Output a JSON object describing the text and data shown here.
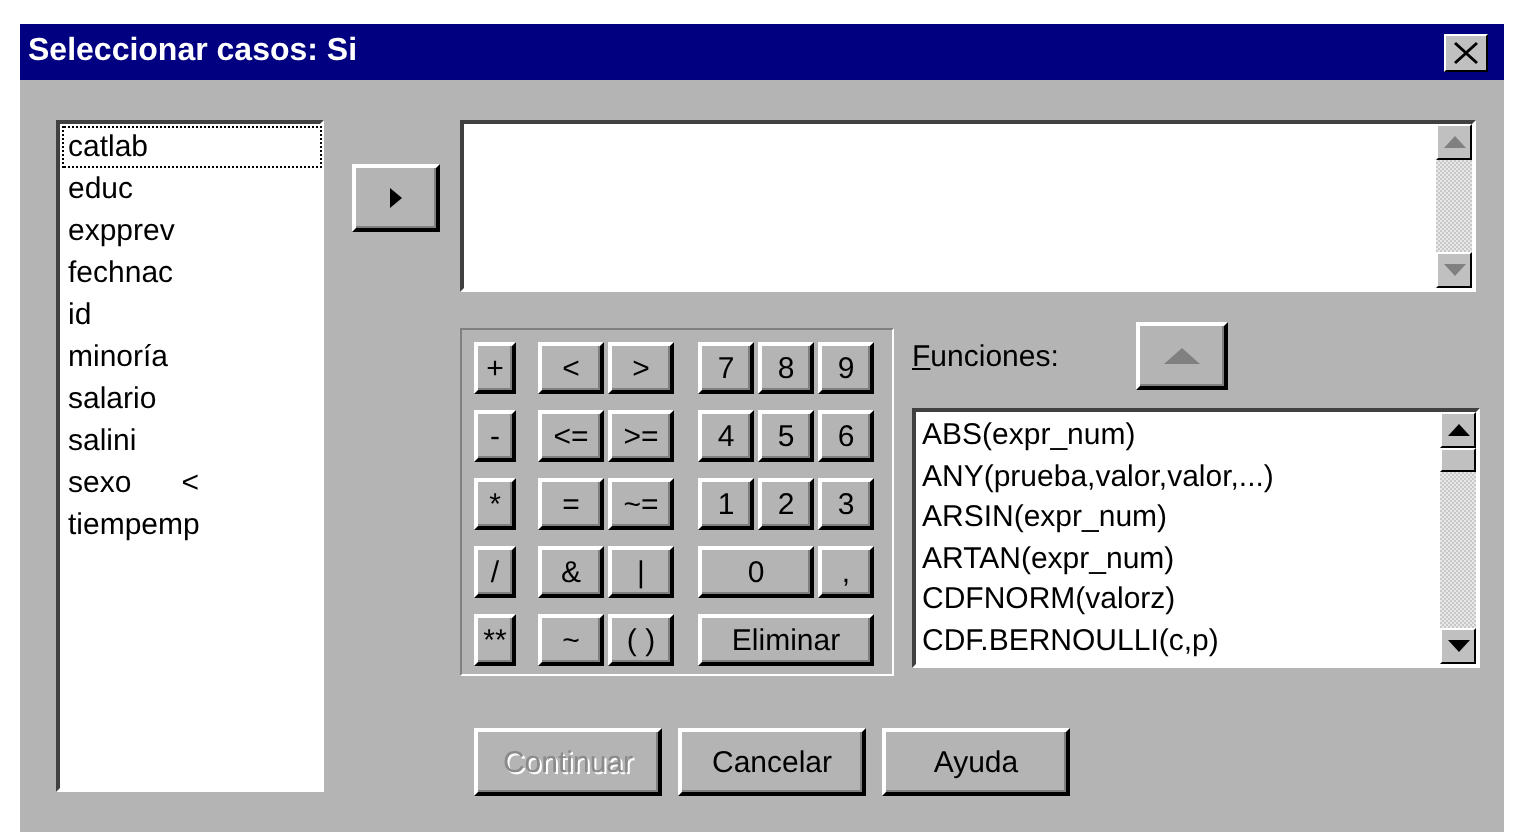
{
  "window": {
    "title": "Seleccionar casos: Si"
  },
  "variables": [
    {
      "name": "catlab",
      "selected": true
    },
    {
      "name": "educ",
      "selected": false
    },
    {
      "name": "expprev",
      "selected": false
    },
    {
      "name": "fechnac",
      "selected": false
    },
    {
      "name": "id",
      "selected": false
    },
    {
      "name": "minoría",
      "selected": false
    },
    {
      "name": "salario",
      "selected": false
    },
    {
      "name": "salini",
      "selected": false
    },
    {
      "name": "sexo      <",
      "selected": false
    },
    {
      "name": "tiempemp",
      "selected": false
    }
  ],
  "keypad": {
    "rows": [
      {
        "operator": "+",
        "relations": [
          "<",
          ">"
        ],
        "digits": [
          "7",
          "8",
          "9"
        ]
      },
      {
        "operator": "-",
        "relations": [
          "<=",
          ">="
        ],
        "digits": [
          "4",
          "5",
          "6"
        ]
      },
      {
        "operator": "*",
        "relations": [
          "=",
          "~="
        ],
        "digits": [
          "1",
          "2",
          "3"
        ]
      },
      {
        "operator": "/",
        "relations": [
          "&",
          "|"
        ],
        "digits": [
          "0",
          ","
        ]
      },
      {
        "operator": "**",
        "relations": [
          "~",
          "( )"
        ],
        "digits": [
          "Eliminar"
        ]
      }
    ]
  },
  "functions": {
    "label": "Funciones:",
    "items": [
      "ABS(expr_num)",
      "ANY(prueba,valor,valor,...)",
      "ARSIN(expr_num)",
      "ARTAN(expr_num)",
      "CDFNORM(valorz)",
      "CDF.BERNOULLI(c,p)"
    ]
  },
  "buttons": [
    {
      "label": "Continuar",
      "disabled": true
    },
    {
      "label": "Cancelar",
      "disabled": false
    },
    {
      "label": "Ayuda",
      "disabled": false
    }
  ]
}
